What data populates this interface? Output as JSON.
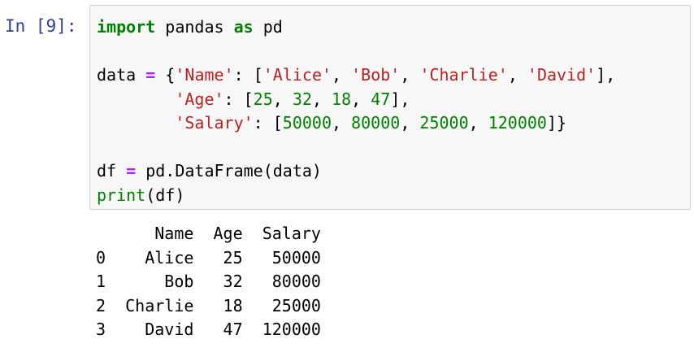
{
  "cell": {
    "prompt": "In [9]:",
    "code_lines": [
      [
        {
          "t": "import",
          "c": "kw"
        },
        {
          "t": " pandas ",
          "c": ""
        },
        {
          "t": "as",
          "c": "kw"
        },
        {
          "t": " pd",
          "c": ""
        }
      ],
      [],
      [
        {
          "t": "data ",
          "c": ""
        },
        {
          "t": "=",
          "c": "op"
        },
        {
          "t": " {",
          "c": ""
        },
        {
          "t": "'Name'",
          "c": "str"
        },
        {
          "t": ": [",
          "c": ""
        },
        {
          "t": "'Alice'",
          "c": "str"
        },
        {
          "t": ", ",
          "c": ""
        },
        {
          "t": "'Bob'",
          "c": "str"
        },
        {
          "t": ", ",
          "c": ""
        },
        {
          "t": "'Charlie'",
          "c": "str"
        },
        {
          "t": ", ",
          "c": ""
        },
        {
          "t": "'David'",
          "c": "str"
        },
        {
          "t": "],",
          "c": ""
        }
      ],
      [
        {
          "t": "        ",
          "c": ""
        },
        {
          "t": "'Age'",
          "c": "str"
        },
        {
          "t": ": [",
          "c": ""
        },
        {
          "t": "25",
          "c": "num"
        },
        {
          "t": ", ",
          "c": ""
        },
        {
          "t": "32",
          "c": "num"
        },
        {
          "t": ", ",
          "c": ""
        },
        {
          "t": "18",
          "c": "num"
        },
        {
          "t": ", ",
          "c": ""
        },
        {
          "t": "47",
          "c": "num"
        },
        {
          "t": "],",
          "c": ""
        }
      ],
      [
        {
          "t": "        ",
          "c": ""
        },
        {
          "t": "'Salary'",
          "c": "str"
        },
        {
          "t": ": [",
          "c": ""
        },
        {
          "t": "50000",
          "c": "num"
        },
        {
          "t": ", ",
          "c": ""
        },
        {
          "t": "80000",
          "c": "num"
        },
        {
          "t": ", ",
          "c": ""
        },
        {
          "t": "25000",
          "c": "num"
        },
        {
          "t": ", ",
          "c": ""
        },
        {
          "t": "120000",
          "c": "num"
        },
        {
          "t": "]}",
          "c": ""
        }
      ],
      [],
      [
        {
          "t": "df ",
          "c": ""
        },
        {
          "t": "=",
          "c": "op"
        },
        {
          "t": " pd.DataFrame(data)",
          "c": ""
        }
      ],
      [
        {
          "t": "print",
          "c": "bi"
        },
        {
          "t": "(df)",
          "c": ""
        }
      ]
    ],
    "output_lines": [
      "      Name  Age  Salary",
      "0    Alice   25   50000",
      "1      Bob   32   80000",
      "2  Charlie   18   25000",
      "3    David   47  120000"
    ]
  },
  "colors": {
    "prompt": "#303f9f",
    "keyword": "#008000",
    "operator": "#aa22ff",
    "string": "#ba2121",
    "number": "#008000",
    "input_background": "#f7f7f7",
    "input_border": "#cfcfcf"
  }
}
